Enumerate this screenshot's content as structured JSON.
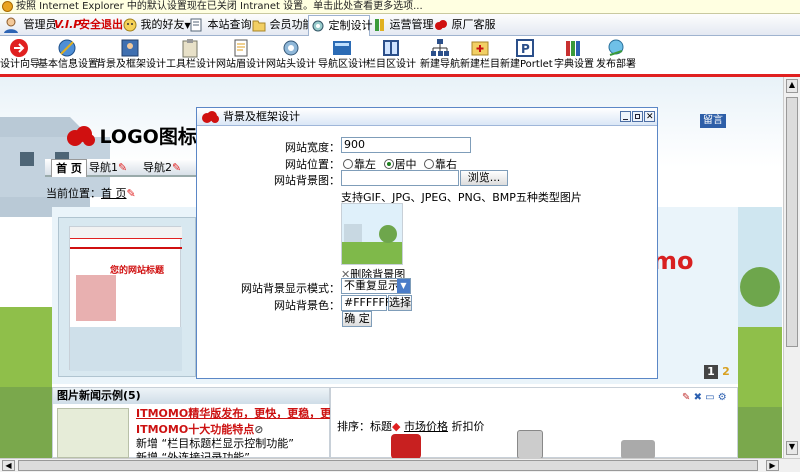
{
  "infobar": {
    "text": "按照 Internet Explorer 中的默认设置现在已关闭 Intranet 设置。单击此处查看更多选项..."
  },
  "menubar": {
    "user": "管理员",
    "vip": "V.I.P",
    "logout": "安全退出",
    "friends": "我的好友",
    "friends_arrow": "▼",
    "site_search": "本站查询",
    "member_func": "会员功能",
    "custom_design": "定制设计",
    "operations": "运营管理",
    "vendor_service": "原厂客服"
  },
  "toolbar": [
    "设计向导",
    "基本信息设置",
    "背景及框架设计",
    "工具栏设计",
    "网站眉设计",
    "网站头设计",
    "导航区设计",
    "栏目区设计",
    "新建导航",
    "新建栏目",
    "新建Portlet",
    "字典设置",
    "发布部署"
  ],
  "site": {
    "logo": "LOGO图标",
    "message": "留言",
    "nav": [
      "首 页",
      "导航1",
      "导航2"
    ],
    "breadcrumb_label": "当前位置：",
    "breadcrumb_link": "首 页",
    "banner_text": "mo",
    "pager": [
      "1",
      "2"
    ],
    "inner_title": "您的网站标题",
    "news_title": "图片新闻示例(5)",
    "headline1": "ITMOMO精华版发布，更快，更稳，更安全",
    "headline2": "ITMOMO十大功能特点",
    "add1": "新增 “栏目标题栏显示控制功能”",
    "add2": "新增 “外连接记录功能”",
    "sort_label": "排序：",
    "sort1": "标题",
    "sort2": "市场价格",
    "sort3": "折扣价"
  },
  "dialog": {
    "title": "背景及框架设计",
    "width_label": "网站宽度：",
    "width_value": "900",
    "position_label": "网站位置：",
    "pos_left": "靠左",
    "pos_center": "居中",
    "pos_right": "靠右",
    "bg_image_label": "网站背景图：",
    "browse_button": "浏览...",
    "hint": "支持GIF、JPG、JPEG、PNG、BMP五种类型图片",
    "delete_bg": "删除背景图",
    "display_mode_label": "网站背景显示模式：",
    "display_mode_value": "不重复显示",
    "bg_color_label": "网站背景色：",
    "bg_color_value": "#FFFFFF",
    "select_button": "选择",
    "ok_button": "确 定"
  },
  "colors": {
    "accent_red": "#e02020",
    "link_blue": "#1a3a9a",
    "headline_red": "#cc1111"
  }
}
